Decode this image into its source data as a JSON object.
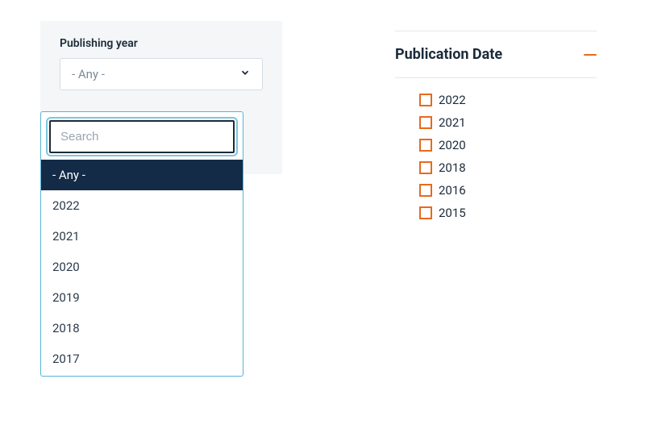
{
  "publishing_year": {
    "label": "Publishing year",
    "selected": "- Any -",
    "search_placeholder": "Search",
    "options": [
      "- Any -",
      "2022",
      "2021",
      "2020",
      "2019",
      "2018",
      "2017"
    ]
  },
  "publication_date": {
    "title": "Publication Date",
    "options": [
      "2022",
      "2021",
      "2020",
      "2018",
      "2016",
      "2015"
    ]
  }
}
